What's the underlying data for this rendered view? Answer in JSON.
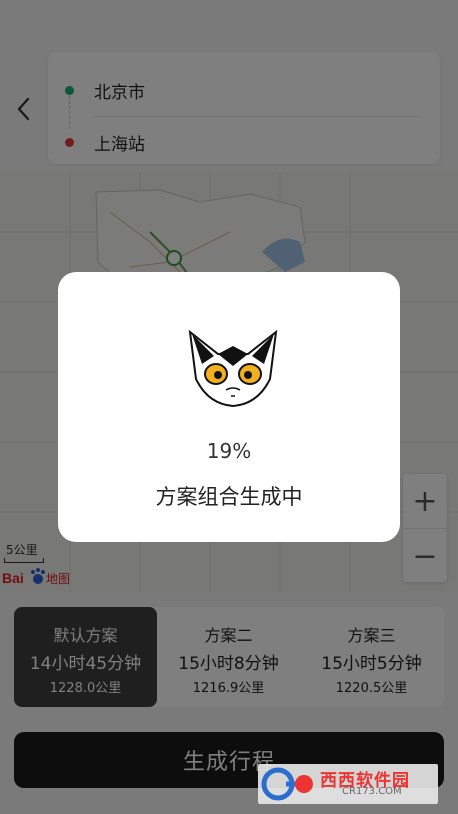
{
  "header": {
    "back_icon": "chevron-left-icon",
    "origin": "北京市",
    "destination": "上海站",
    "origin_color": "#19b36b",
    "destination_color": "#e23a3a"
  },
  "map": {
    "scale_label": "5公里",
    "logo_text": "Bai地图",
    "zoom_in": "+",
    "zoom_out": "−"
  },
  "plans": [
    {
      "name": "默认方案",
      "time": "14小时45分钟",
      "distance": "1228.0公里",
      "selected": true
    },
    {
      "name": "方案二",
      "time": "15小时8分钟",
      "distance": "1216.9公里",
      "selected": false
    },
    {
      "name": "方案三",
      "time": "15小时5分钟",
      "distance": "1220.5公里",
      "selected": false
    }
  ],
  "actions": {
    "generate_label": "生成行程"
  },
  "dialog": {
    "progress_text": "19%",
    "status_text": "方案组合生成中",
    "progress": 0.19,
    "illustration": "cat-mascot-icon"
  },
  "watermark": {
    "text": "西西软件园",
    "sub": "CR173.COM"
  }
}
